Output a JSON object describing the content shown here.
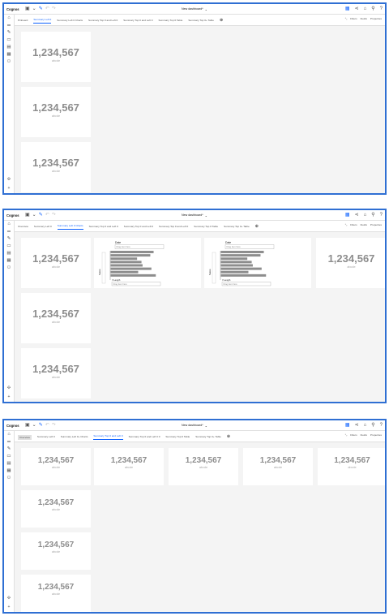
{
  "app": {
    "brand": "Cognos",
    "dashboard_title": "New dashboard*"
  },
  "toolbar_right": {
    "filters": "Filters",
    "fields": "Fields",
    "properties": "Properties"
  },
  "kpi": {
    "value": "1,234,567",
    "label": "abcde"
  },
  "screens": [
    {
      "tabs": [
        "Pinboard",
        "Summary Left 0",
        "Summary Left 0 Charts",
        "Summary Top 0 and Left 0",
        "Summary Top 0 and Left 0",
        "Summary Top 0 Table",
        "Summary Top 0+ Table"
      ],
      "active_tab": 1
    },
    {
      "tabs": [
        "Overview",
        "Summary Left 0",
        "Summary Left 0 Charts",
        "Summary Top 0 and Left 0",
        "Summary Top 0 and Left 0",
        "Summary Top 0 and Left 0",
        "Summary Top 0 Table",
        "Summary Top 0+ Table"
      ],
      "active_tab": 2
    },
    {
      "tabs": [
        "Overview",
        "Summary Left 0",
        "Summary Left 0+ Charts",
        "Summary Top 0 and Left 0",
        "Summary Top 0 and Left 0 0",
        "Summary Top 0 Table",
        "Summary Top 0+ Table"
      ],
      "active_tab": 3
    }
  ],
  "chart": {
    "type": "bar",
    "title": "Date",
    "subtitle": "Drag item here",
    "y_label": "Sales",
    "x_label": "Y-Length",
    "x_placeholder": "Drag item here",
    "values": [
      0.78,
      0.72,
      0.48,
      0.56,
      0.58,
      0.74,
      0.5,
      0.82
    ]
  }
}
